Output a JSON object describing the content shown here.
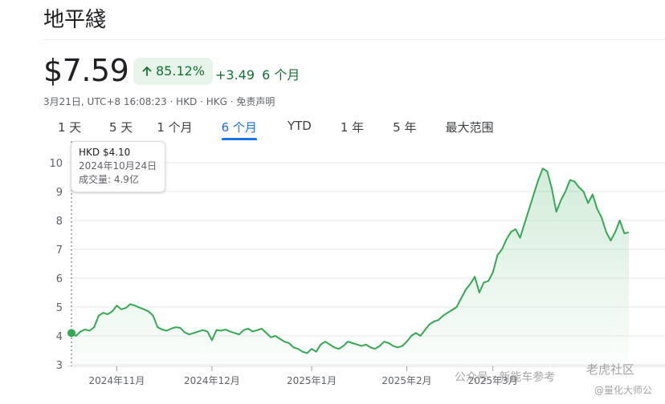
{
  "stock": {
    "name": "地平綫",
    "price": "$7.59",
    "change_pct": "85.12%",
    "change_abs": "+3.49",
    "change_period": "6 个月",
    "meta": "3月21日, UTC+8 16:08:23 · HKD · HKG · 免责声明",
    "up_color": "#137333",
    "accent": "#1a73e8"
  },
  "tabs": [
    {
      "label": "1 天"
    },
    {
      "label": "5 天"
    },
    {
      "label": "1 个月"
    },
    {
      "label": "6 个月",
      "active": true
    },
    {
      "label": "YTD"
    },
    {
      "label": "1 年"
    },
    {
      "label": "5 年"
    },
    {
      "label": "最大范围"
    }
  ],
  "tooltip": {
    "price": "HKD $4.10",
    "date": "2024年10月24日",
    "volume": "成交量:  4.9亿"
  },
  "watermarks": {
    "left": "公众号 · 新能车参考",
    "right_top": "老虎社区",
    "right_bottom": "@量化大师公"
  },
  "chart_data": {
    "type": "area",
    "x_labels": [
      "2024年11月",
      "2024年12月",
      "2025年1月",
      "2025年2月",
      "2025年3月"
    ],
    "x_label_index": [
      10,
      31,
      53,
      74,
      93
    ],
    "y_ticks": [
      3,
      4,
      5,
      6,
      7,
      8,
      9,
      10
    ],
    "ylim": [
      3,
      10
    ],
    "grid": true,
    "highlight_index": 0,
    "line_color": "#34a853",
    "values": [
      4.1,
      4.0,
      4.15,
      4.22,
      4.18,
      4.3,
      4.7,
      4.8,
      4.75,
      4.85,
      5.05,
      4.92,
      4.97,
      5.1,
      5.05,
      4.98,
      4.92,
      4.85,
      4.7,
      4.3,
      4.22,
      4.18,
      4.25,
      4.3,
      4.28,
      4.12,
      4.05,
      4.1,
      4.15,
      4.2,
      4.15,
      3.85,
      4.2,
      4.18,
      4.22,
      4.15,
      4.1,
      4.05,
      4.2,
      4.25,
      4.15,
      4.2,
      4.25,
      4.1,
      3.95,
      4.0,
      3.9,
      3.8,
      3.75,
      3.6,
      3.55,
      3.45,
      3.4,
      3.55,
      3.45,
      3.7,
      3.8,
      3.7,
      3.6,
      3.55,
      3.65,
      3.8,
      3.75,
      3.7,
      3.65,
      3.7,
      3.6,
      3.55,
      3.65,
      3.8,
      3.75,
      3.65,
      3.6,
      3.65,
      3.8,
      4.0,
      4.1,
      4.0,
      4.2,
      4.4,
      4.5,
      4.55,
      4.7,
      4.8,
      4.9,
      5.0,
      5.3,
      5.6,
      5.8,
      6.05,
      5.5,
      5.85,
      5.9,
      6.2,
      6.8,
      7.0,
      7.35,
      7.6,
      7.7,
      7.4,
      7.9,
      8.4,
      8.9,
      9.4,
      9.8,
      9.7,
      9.1,
      8.3,
      8.7,
      9.0,
      9.4,
      9.35,
      9.15,
      9.0,
      8.6,
      8.9,
      8.4,
      8.1,
      7.6,
      7.3,
      7.6,
      8.0,
      7.55,
      7.59
    ]
  }
}
